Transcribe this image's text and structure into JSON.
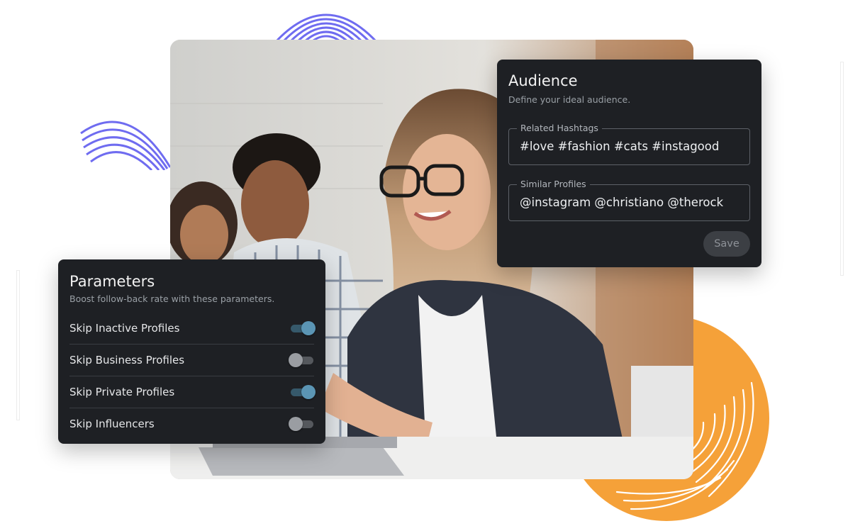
{
  "audience": {
    "title": "Audience",
    "subtitle": "Define your ideal audience.",
    "fields": [
      {
        "label": "Related Hashtags",
        "value": "#love #fashion #cats #instagood"
      },
      {
        "label": "Similar Profiles",
        "value": "@instagram @christiano @therock"
      }
    ],
    "save_label": "Save"
  },
  "parameters": {
    "title": "Parameters",
    "subtitle": "Boost follow-back rate with these parameters.",
    "options": [
      {
        "label": "Skip Inactive Profiles",
        "enabled": true
      },
      {
        "label": "Skip Business Profiles",
        "enabled": false
      },
      {
        "label": "Skip Private Profiles",
        "enabled": true
      },
      {
        "label": "Skip Influencers",
        "enabled": false
      }
    ]
  },
  "colors": {
    "panel_bg": "#1e2024",
    "toggle_on": "#5b95b4",
    "doodle_purple": "#6f6cf0",
    "doodle_orange": "#f5a139"
  }
}
